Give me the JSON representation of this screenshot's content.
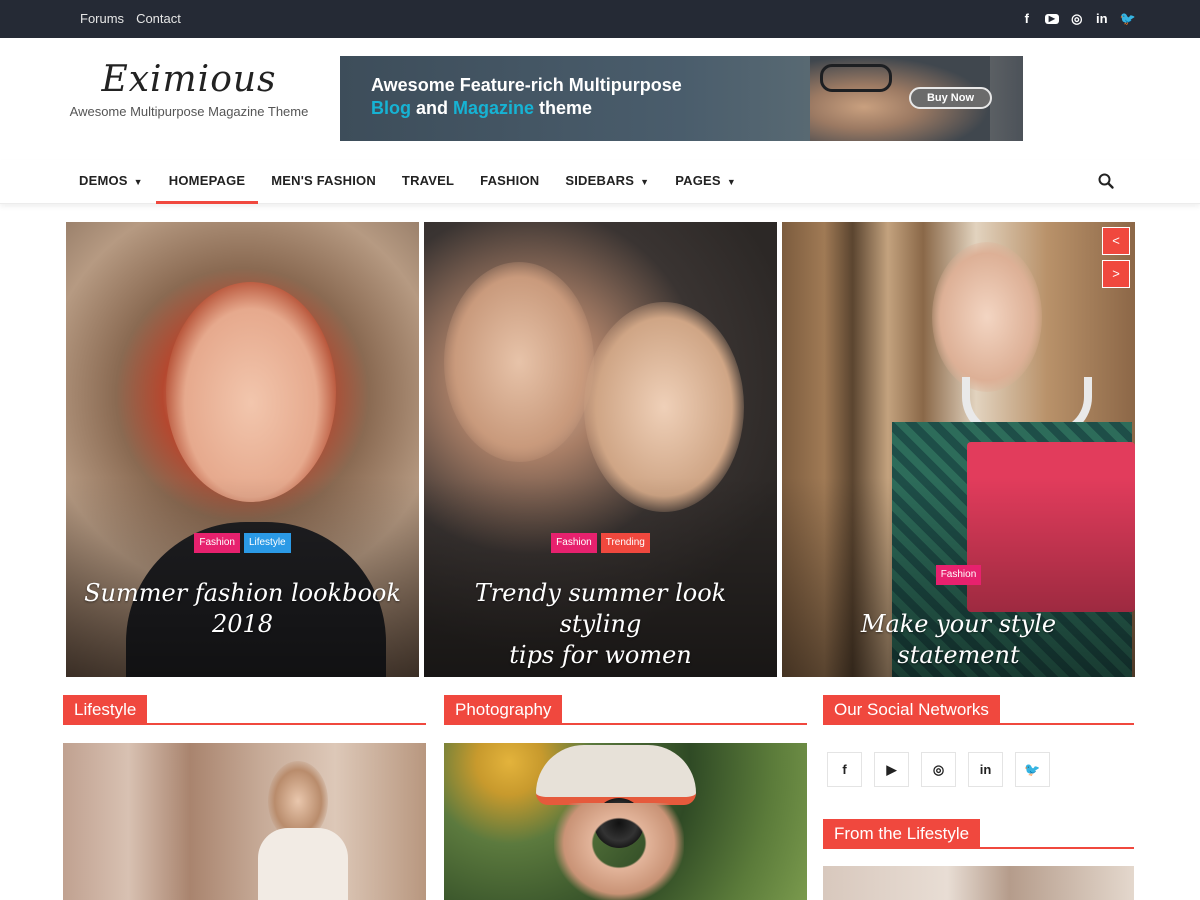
{
  "topbar": {
    "links": [
      "Forums",
      "Contact"
    ],
    "social_icons": [
      "facebook-icon",
      "youtube-icon",
      "instagram-icon",
      "linkedin-icon",
      "twitter-icon"
    ]
  },
  "header": {
    "site_title": "Eximious",
    "tagline": "Awesome Multipurpose Magazine Theme"
  },
  "banner": {
    "line1": "Awesome Feature-rich Multipurpose",
    "line2_part1": "Blog",
    "line2_part2": " and ",
    "line2_part3": "Magazine",
    "line2_part4": " theme",
    "button_label": "Buy Now"
  },
  "nav": {
    "items": [
      {
        "label": "DEMOS",
        "dropdown": true
      },
      {
        "label": "HOMEPAGE",
        "active": true
      },
      {
        "label": "MEN'S FASHION"
      },
      {
        "label": "TRAVEL"
      },
      {
        "label": "FASHION"
      },
      {
        "label": "SIDEBARS",
        "dropdown": true
      },
      {
        "label": "PAGES",
        "dropdown": true
      }
    ],
    "search_icon": "search-icon"
  },
  "slider": {
    "slides": [
      {
        "tags": [
          "Fashion",
          "Lifestyle"
        ],
        "title_line1": "Summer fashion lookbook",
        "title_line2": "2018"
      },
      {
        "tags": [
          "Fashion",
          "Trending"
        ],
        "title_line1": "Trendy summer look styling",
        "title_line2": "tips for women"
      },
      {
        "tags": [
          "Fashion"
        ],
        "title_line1": "Make your style statement",
        "title_line2": ""
      }
    ],
    "prev_label": "<",
    "next_label": ">"
  },
  "sections": {
    "lifestyle": "Lifestyle",
    "photography": "Photography",
    "social": "Our Social Networks",
    "from_lifestyle": "From the Lifestyle"
  },
  "social_networks": [
    "f",
    "▶",
    "◎",
    "in",
    "🐦"
  ],
  "colors": {
    "accent": "#f0483e",
    "topbar_bg": "#252a35",
    "tag_pink": "#e7216e",
    "tag_blue": "#2b9ae6",
    "banner_highlight": "#16b3d4"
  }
}
